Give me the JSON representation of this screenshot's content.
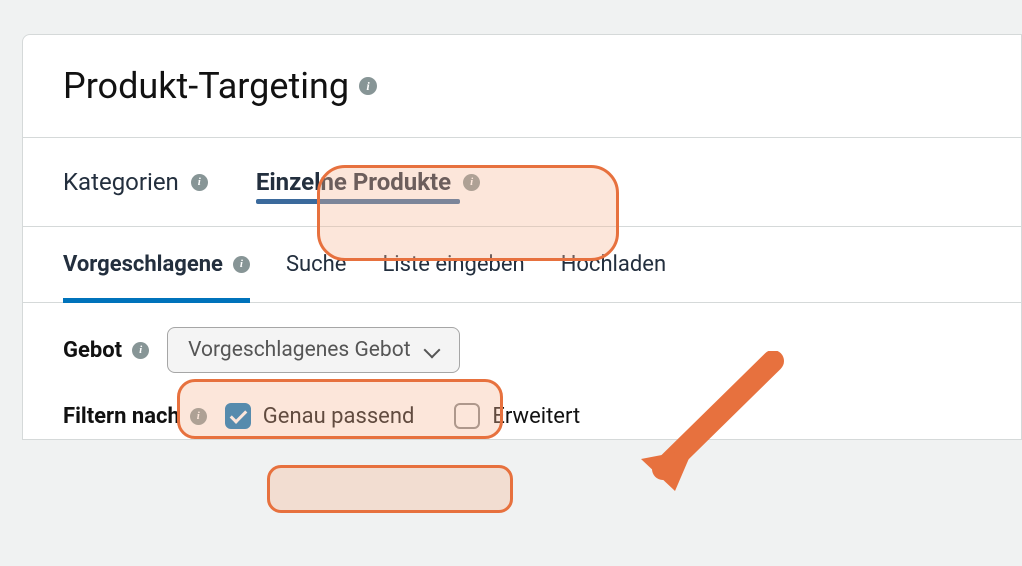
{
  "heading": {
    "title": "Produkt-Targeting"
  },
  "tabs": {
    "categories": "Kategorien",
    "individual_products": "Einzelne Produkte"
  },
  "subtabs": {
    "suggested": "Vorgeschlagene",
    "search": "Suche",
    "enter_list": "Liste eingeben",
    "upload": "Hochladen"
  },
  "bid": {
    "label": "Gebot",
    "dropdown_value": "Vorgeschlagenes Gebot"
  },
  "filter": {
    "label": "Filtern nach",
    "exact_label": "Genau passend",
    "expanded_label": "Erweitert"
  },
  "colors": {
    "highlight_border": "#e7713e",
    "accent": "#0073bb"
  }
}
